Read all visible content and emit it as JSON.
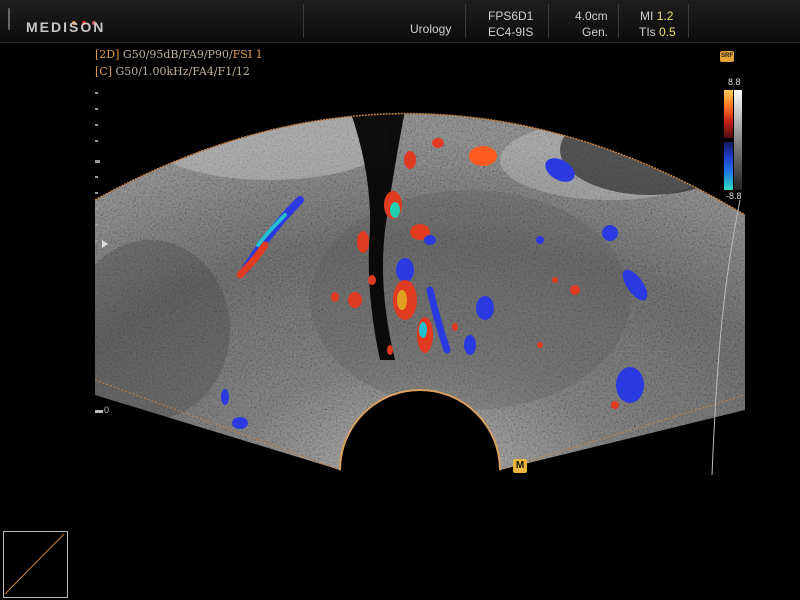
{
  "header": {
    "brand": "MEDISON",
    "preset": "Urology",
    "probe_code": "FPS6D1",
    "probe_name": "EC4-9IS",
    "depth": "4.0cm",
    "frequency_mode": "Gen.",
    "mi_label": "MI",
    "mi_value": "1.2",
    "tis_label": "TIs",
    "tis_value": "0.5"
  },
  "params": {
    "line1_tag": "[2D]",
    "line1_text": "G50/95dB/FA9/P90/",
    "line1_fsi": "FSI 1",
    "line2_tag": "[C]",
    "line2_text": "G50/1.00kHz/FA4/F1/12"
  },
  "color_scale": {
    "max": "8.8",
    "min": "-8.8",
    "badge": "SRF"
  },
  "depth_scale": {
    "zero": "0"
  },
  "marker_badge": "M",
  "colors": {
    "flow_warm": "#e03a20",
    "flow_cold": "#2a3ae0",
    "fan_outline": "#c88040",
    "accent": "#e8b43c"
  },
  "icons": [
    "probe-orientation-icon",
    "depth-scale-icon",
    "color-map-icon",
    "body-marker-icon"
  ]
}
